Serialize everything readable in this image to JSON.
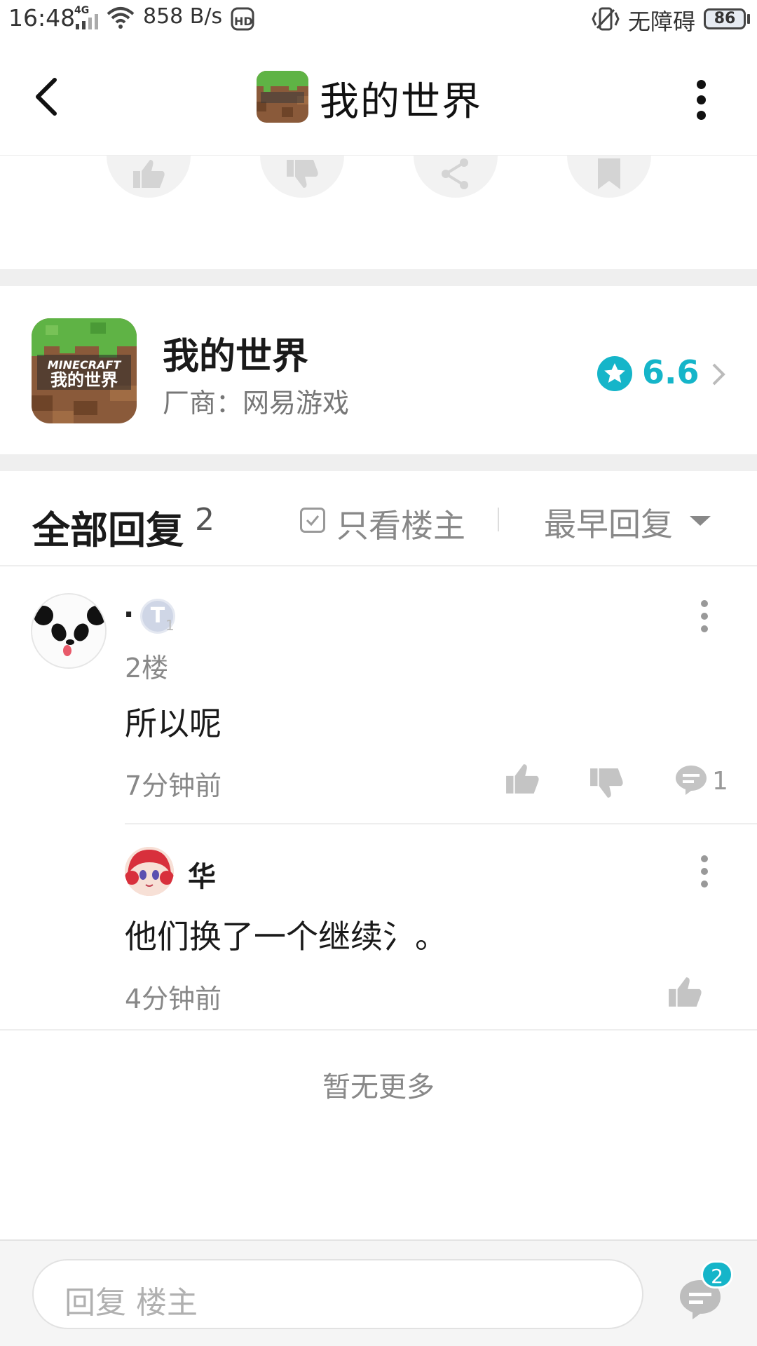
{
  "status_bar": {
    "time": "16:48",
    "signal_label": "4G",
    "speed": "858 B/s",
    "accessibility": "无障碍",
    "battery": "86"
  },
  "header": {
    "title": "我的世界",
    "icons": [
      "back-arrow-icon",
      "minecraft-app-icon",
      "more-vertical-icon"
    ]
  },
  "actions": {
    "icons": [
      "thumbs-up-icon",
      "thumbs-down-icon",
      "share-icon",
      "bookmark-icon"
    ]
  },
  "game": {
    "name": "我的世界",
    "vendor": "厂商：网易游戏",
    "rating": "6.6",
    "icon_text": "MINECRAFT"
  },
  "replies": {
    "title": "全部回复",
    "count": "2",
    "op_only_label": "只看楼主",
    "sort_label": "最早回复"
  },
  "comment": {
    "author": "·",
    "badge": "T",
    "badge_sub": "1",
    "floor": "2楼",
    "text": "所以呢",
    "time": "7分钟前",
    "reply_count": "1"
  },
  "subreply": {
    "author": "华",
    "text": "他们换了一个继续氵。",
    "time": "4分钟前"
  },
  "footer": {
    "no_more": "暂无更多",
    "reply_placeholder": "回复  楼主",
    "comments_badge": "2"
  },
  "colors": {
    "accent": "#15b5c9",
    "muted_text": "#888888",
    "divider": "#efefef"
  }
}
